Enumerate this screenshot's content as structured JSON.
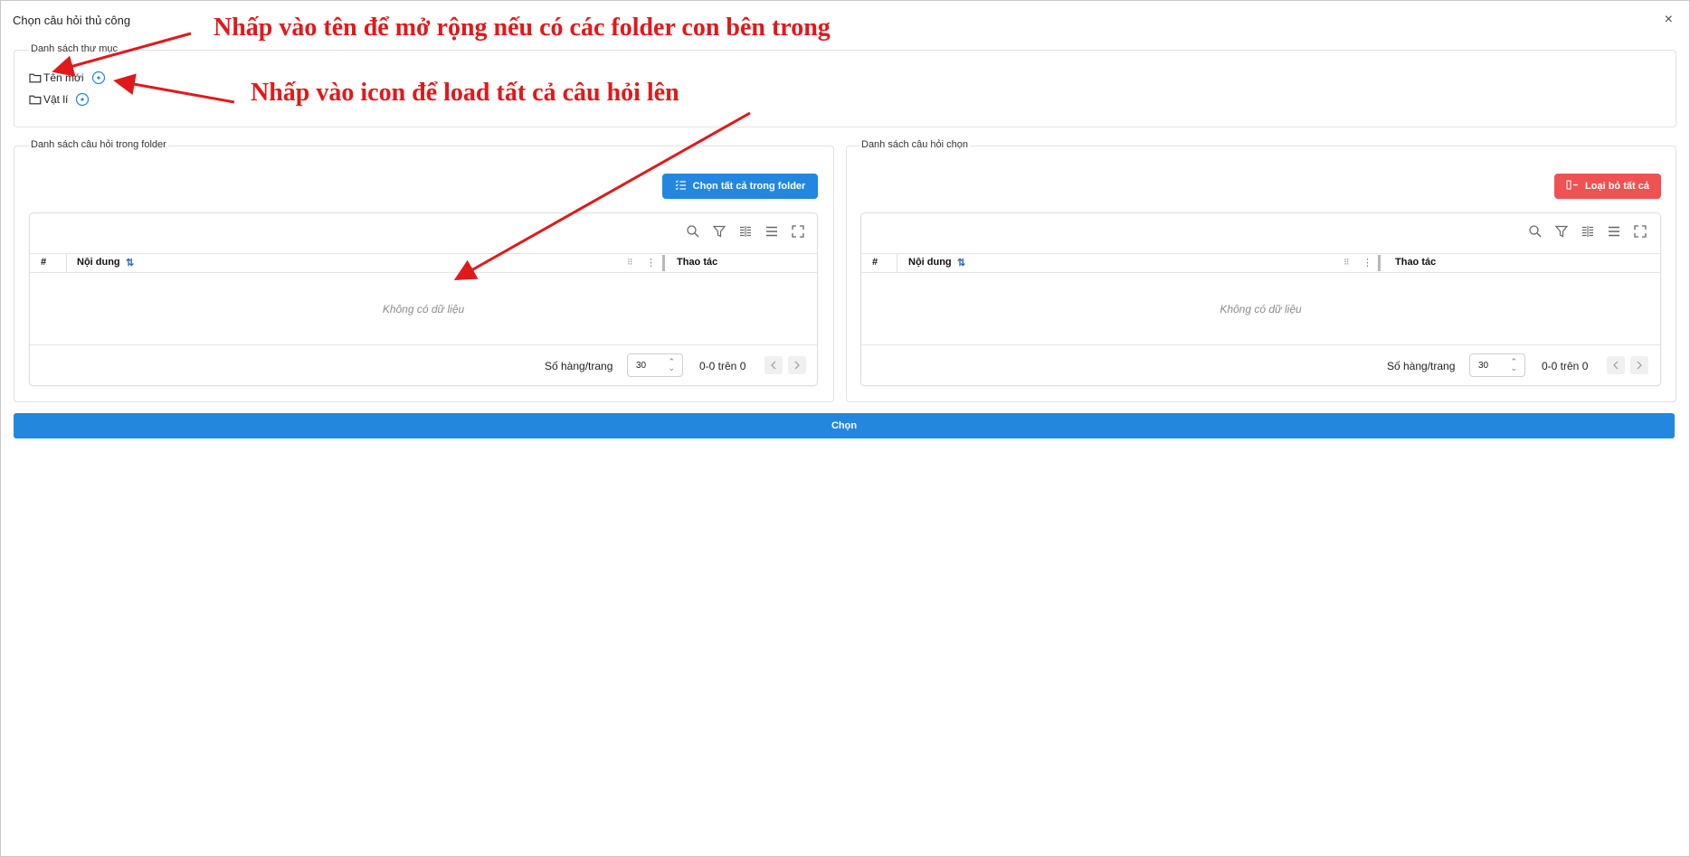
{
  "dialog": {
    "title": "Chọn câu hỏi thủ công",
    "close_glyph": "×"
  },
  "folders": {
    "legend": "Danh sách thư mục",
    "items": [
      {
        "name": "Tên mới",
        "icon": "folder-icon",
        "action_icon": "load-questions-icon"
      },
      {
        "name": "Vật lí",
        "icon": "folder-icon",
        "action_icon": "load-questions-icon"
      }
    ]
  },
  "left_panel": {
    "legend": "Danh sách câu hỏi trong folder",
    "action_button": "Chọn tất cả trong folder",
    "action_button_color": "#2387e0",
    "table": {
      "columns": [
        "#",
        "Nội dung",
        "Thao tác"
      ],
      "empty_text": "Không có dữ liệu",
      "rows_per_page_label": "Số hàng/trang",
      "rows_per_page_value": "30",
      "range_text": "0-0 trên 0"
    }
  },
  "right_panel": {
    "legend": "Danh sách câu hỏi chọn",
    "action_button": "Loại bỏ tất cả",
    "action_button_color": "#f05252",
    "table": {
      "columns": [
        "#",
        "Nội dung",
        "Thao tác"
      ],
      "empty_text": "Không có dữ liệu",
      "rows_per_page_label": "Số hàng/trang",
      "rows_per_page_value": "30",
      "range_text": "0-0 trên 0"
    }
  },
  "toolbar_icons": [
    "search-icon",
    "filter-icon",
    "columns-icon",
    "density-icon",
    "fullscreen-icon"
  ],
  "submit_button": "Chọn",
  "annotations": {
    "top": "Nhấp vào tên để mở rộng nếu có các folder con bên trong",
    "middle": "Nhấp vào icon để load tất cả câu hỏi lên",
    "color": "#e0191b"
  }
}
